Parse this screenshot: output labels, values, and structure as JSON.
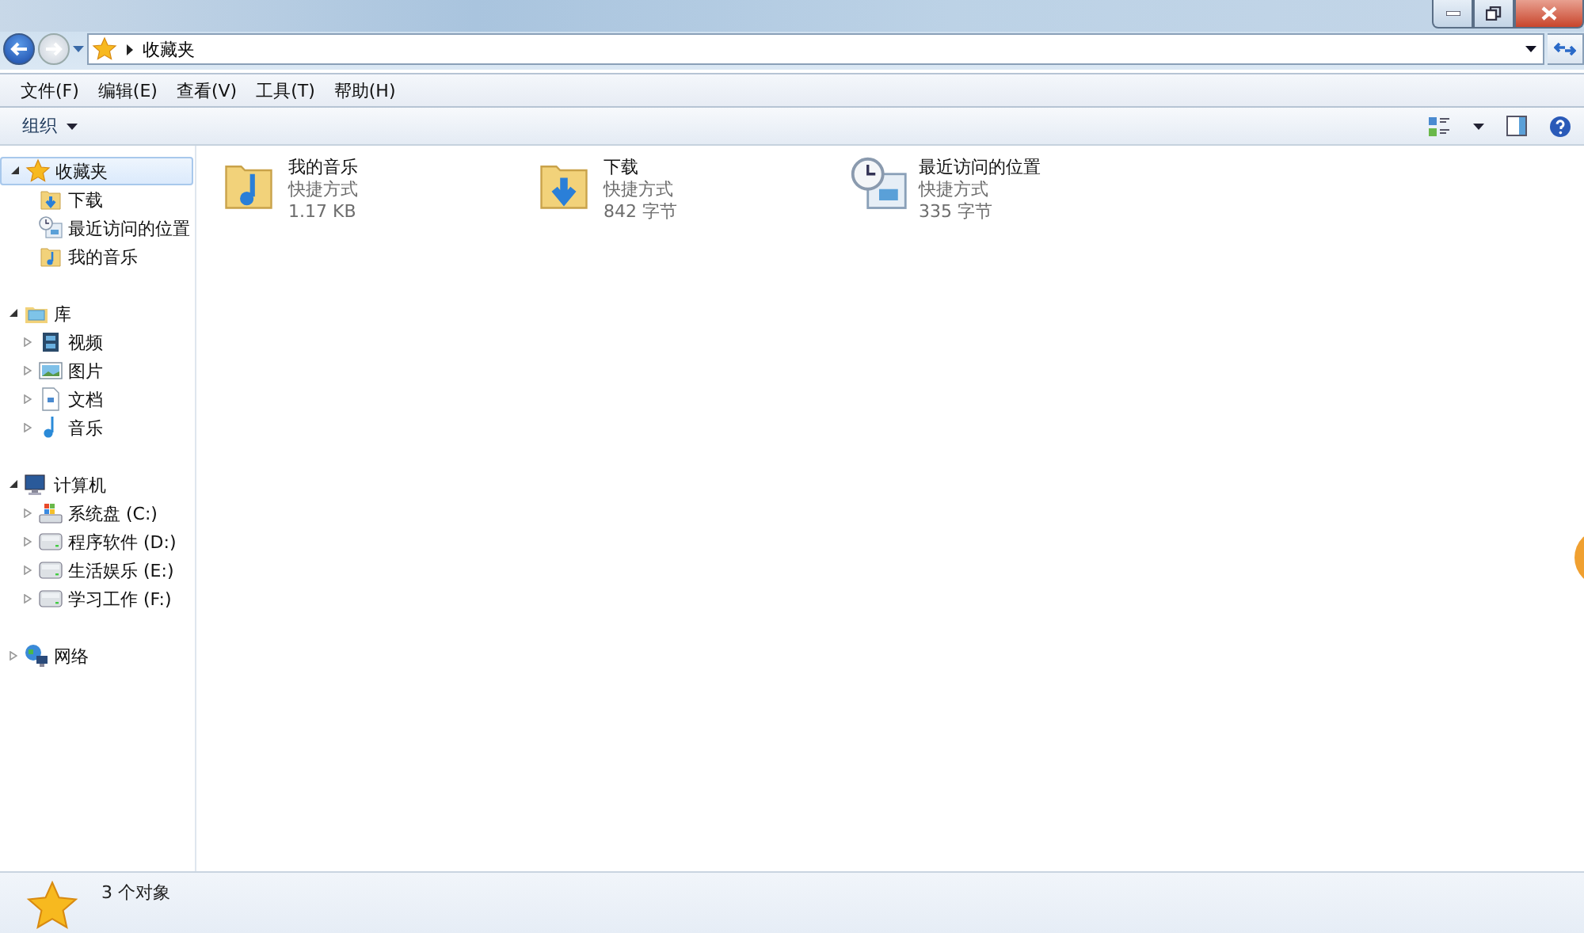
{
  "address": {
    "crumbs": [
      "收藏夹"
    ]
  },
  "menu": [
    "文件(F)",
    "编辑(E)",
    "查看(V)",
    "工具(T)",
    "帮助(H)"
  ],
  "toolbar": {
    "organize": "组织"
  },
  "sidebar": {
    "groups": [
      {
        "label": "收藏夹",
        "kind": "star",
        "expanded": true,
        "selected": true,
        "children": [
          {
            "label": "下载",
            "kind": "folder-download"
          },
          {
            "label": "最近访问的位置",
            "kind": "recent"
          },
          {
            "label": "我的音乐",
            "kind": "folder-music"
          }
        ]
      },
      {
        "label": "库",
        "kind": "library",
        "expanded": true,
        "selected": false,
        "children": [
          {
            "label": "视频",
            "kind": "video",
            "expanded": false
          },
          {
            "label": "图片",
            "kind": "picture",
            "expanded": false
          },
          {
            "label": "文档",
            "kind": "document",
            "expanded": false
          },
          {
            "label": "音乐",
            "kind": "music",
            "expanded": false
          }
        ]
      },
      {
        "label": "计算机",
        "kind": "computer",
        "expanded": true,
        "selected": false,
        "children": [
          {
            "label": "系统盘 (C:)",
            "kind": "system-drive",
            "expanded": false
          },
          {
            "label": "程序软件 (D:)",
            "kind": "drive",
            "expanded": false
          },
          {
            "label": "生活娱乐 (E:)",
            "kind": "drive",
            "expanded": false
          },
          {
            "label": "学习工作 (F:)",
            "kind": "drive",
            "expanded": false
          }
        ]
      },
      {
        "label": "网络",
        "kind": "network",
        "expanded": false,
        "selected": false
      }
    ]
  },
  "files": [
    {
      "name": "我的音乐",
      "type": "快捷方式",
      "size": "1.17 KB",
      "kind": "folder-music"
    },
    {
      "name": "下载",
      "type": "快捷方式",
      "size": "842 字节",
      "kind": "folder-download"
    },
    {
      "name": "最近访问的位置",
      "type": "快捷方式",
      "size": "335 字节",
      "kind": "recent"
    }
  ],
  "status_bar": {
    "count": "3 个对象"
  }
}
